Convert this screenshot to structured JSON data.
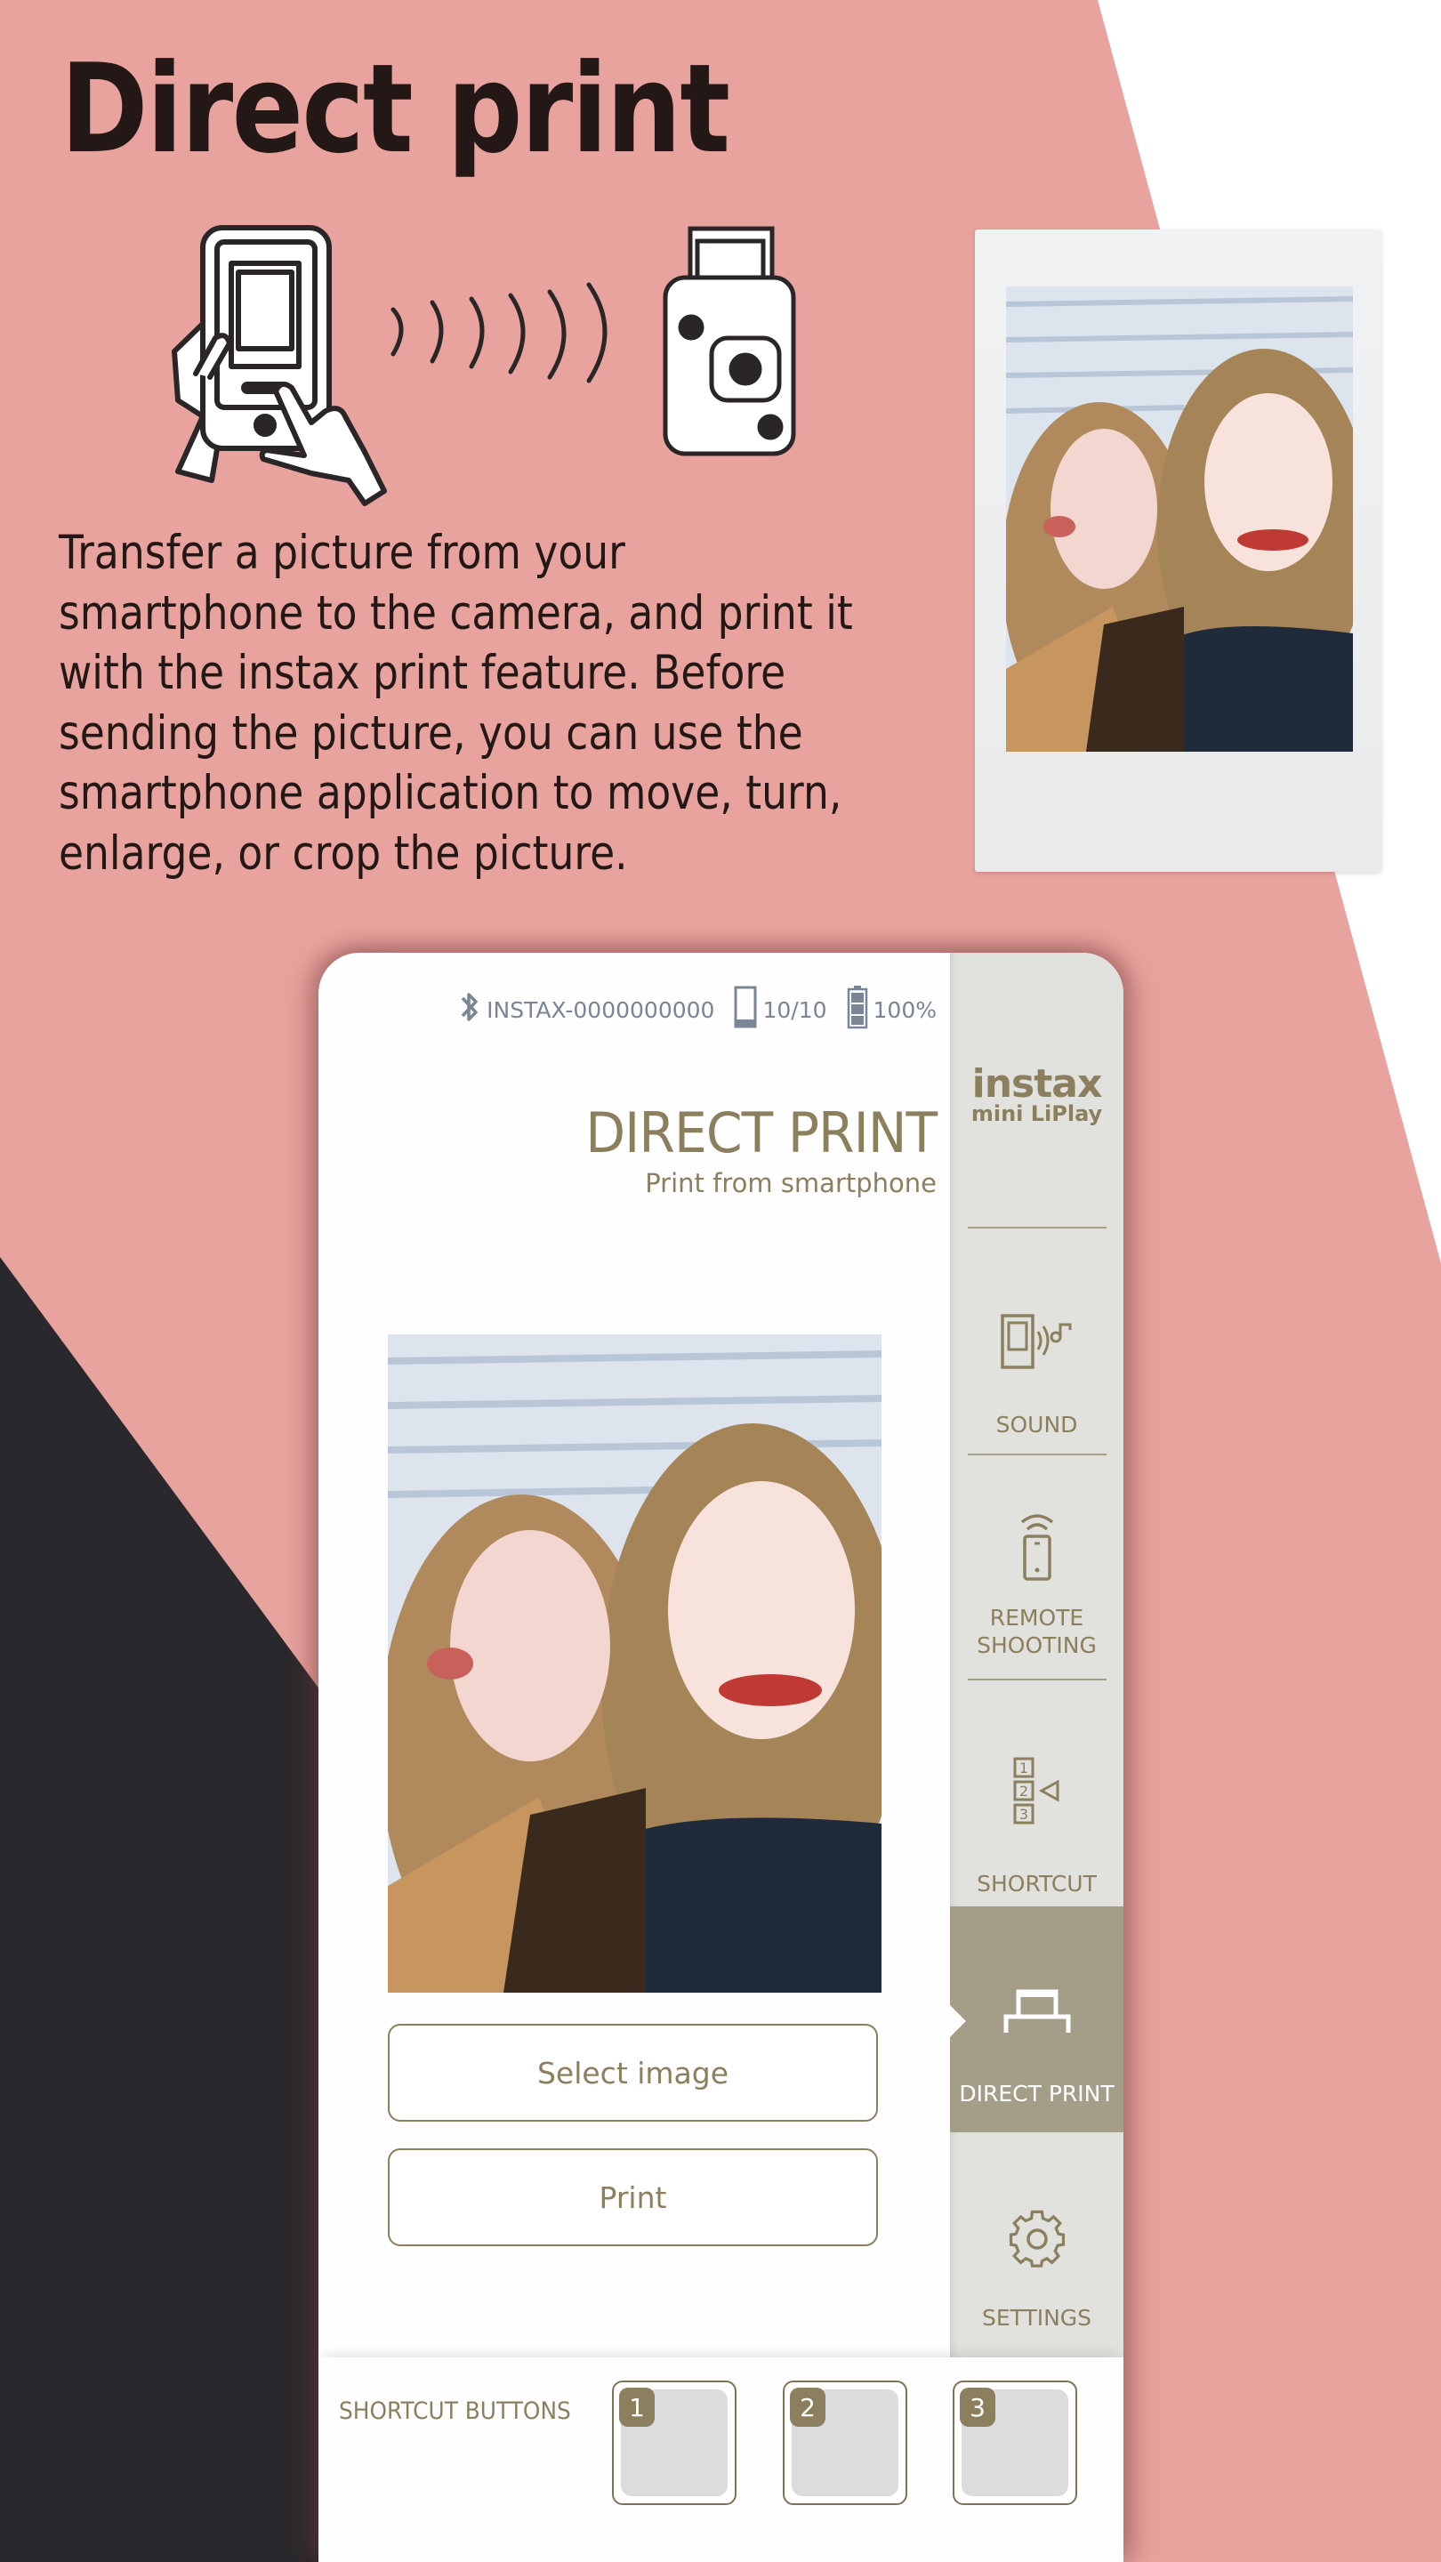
{
  "colors": {
    "background_pink": "#e8a39e",
    "background_dark": "#29282c",
    "accent_brown": "#8c7f5e",
    "sidebar_bg": "#e1e1dd",
    "sidebar_active_bg": "#a49d87",
    "status_text": "#7a8596"
  },
  "promo": {
    "headline": "Direct print",
    "description_lines": [
      "Transfer a picture from your",
      "smartphone to the camera, and print it",
      "with the instax print feature. Before",
      "sending the picture, you can use the",
      "smartphone application to move, turn,",
      "enlarge, or crop the picture."
    ],
    "illustration_icons": [
      "hand-holding-phone-icon",
      "wireless-waves-icon",
      "instax-camera-icon"
    ],
    "printed_photo": "instant-print-photo-two-women"
  },
  "app": {
    "status_bar": {
      "bluetooth_icon": "bluetooth-icon",
      "device_name": "INSTAX-0000000000",
      "film_icon": "film-count-icon",
      "film_count": "10/10",
      "battery_icon": "battery-icon",
      "battery": "100%"
    },
    "title": "DIRECT PRINT",
    "subtitle": "Print from smartphone",
    "preview_image": "selected-photo-two-women",
    "buttons": {
      "select_image": "Select image",
      "print": "Print"
    },
    "sidebar": {
      "logo_line1": "instax",
      "logo_line2": "mini LiPlay",
      "items": [
        {
          "label": "SOUND",
          "icon": "sound-icon",
          "active": false
        },
        {
          "label_line1": "REMOTE",
          "label_line2": "SHOOTING",
          "icon": "remote-shooting-icon",
          "active": false
        },
        {
          "label": "SHORTCUT",
          "icon": "shortcut-icon",
          "active": false
        },
        {
          "label": "DIRECT PRINT",
          "icon": "printer-icon",
          "active": true
        },
        {
          "label": "SETTINGS",
          "icon": "gear-icon",
          "active": false
        }
      ]
    },
    "shortcut_bar": {
      "label": "SHORTCUT BUTTONS",
      "slots": [
        {
          "number": "1"
        },
        {
          "number": "2"
        },
        {
          "number": "3"
        }
      ]
    }
  }
}
